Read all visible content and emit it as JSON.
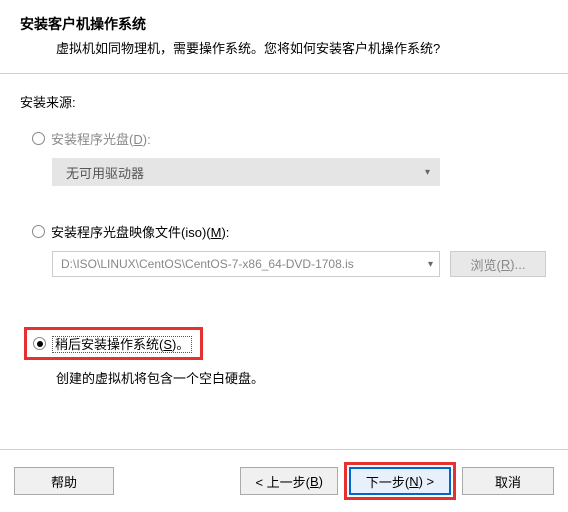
{
  "header": {
    "title": "安装客户机操作系统",
    "subtitle": "虚拟机如同物理机，需要操作系统。您将如何安装客户机操作系统?"
  },
  "sourceLabel": "安装来源:",
  "option1": {
    "labelPrefix": "安装程序光盘(",
    "accessKey": "D",
    "labelSuffix": "):",
    "dropdown": "无可用驱动器"
  },
  "option2": {
    "labelPrefix": "安装程序光盘映像文件(iso)(",
    "accessKey": "M",
    "labelSuffix": "):",
    "path": "D:\\ISO\\LINUX\\CentOS\\CentOS-7-x86_64-DVD-1708.is",
    "browsePrefix": "浏览(",
    "browseKey": "R",
    "browseSuffix": ")..."
  },
  "option3": {
    "labelPrefix": "稍后安装操作系统(",
    "accessKey": "S",
    "labelSuffix": ")。",
    "note": "创建的虚拟机将包含一个空白硬盘。"
  },
  "footer": {
    "help": "帮助",
    "backPrefix": "< 上一步(",
    "backKey": "B",
    "backSuffix": ")",
    "nextPrefix": "下一步(",
    "nextKey": "N",
    "nextSuffix": ") >",
    "cancel": "取消"
  }
}
